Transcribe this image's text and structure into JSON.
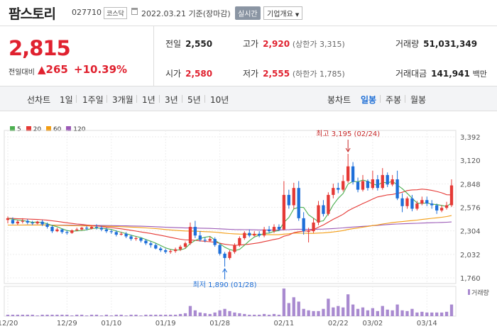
{
  "header": {
    "name": "팜스토리",
    "code": "027710",
    "market": "코스닥",
    "date": "2022.03.21 기준(장마감)",
    "live_label": "실시간",
    "corp_label": "기업개요"
  },
  "quote": {
    "price": "2,815",
    "change_label": "전일대비",
    "change_arrow": "▲",
    "change": "265",
    "change_pct": "+10.39%",
    "prev_close_label": "전일",
    "prev_close": "2,550",
    "open_label": "시가",
    "open": "2,580",
    "high_label": "고가",
    "high": "2,920",
    "upper_limit": "(상한가 3,315)",
    "low_label": "저가",
    "low": "2,555",
    "lower_limit": "(하한가 1,785)",
    "volume_label": "거래량",
    "volume": "51,031,349",
    "amount_label": "거래대금",
    "amount": "141,941",
    "amount_unit": "백만"
  },
  "tabs": {
    "line_chart": "선차트",
    "periods": [
      "1일",
      "1주일",
      "3개월",
      "1년",
      "3년",
      "5년",
      "10년"
    ],
    "candle_chart": "봉차트",
    "candle_periods": [
      "일봉",
      "주봉",
      "월봉"
    ],
    "active_candle": "일봉"
  },
  "legend": [
    {
      "label": "5",
      "color": "#4caf50"
    },
    {
      "label": "20",
      "color": "#e53935"
    },
    {
      "label": "60",
      "color": "#f39c12"
    },
    {
      "label": "120",
      "color": "#9b59b6"
    }
  ],
  "colors": {
    "up": "#e53935",
    "down": "#1e6fd9",
    "volume": "#a98ad0"
  },
  "chart_data": {
    "type": "candlestick",
    "ylim": [
      1760,
      3392
    ],
    "y_ticks": [
      "3,392",
      "3,120",
      "2,848",
      "2,576",
      "2,304",
      "2,032",
      "1,760"
    ],
    "x_tick_labels": [
      "12/20",
      "12/29",
      "01/10",
      "01/19",
      "01/28",
      "02/11",
      "02/22",
      "03/02",
      "03/14"
    ],
    "x_tick_index": [
      0,
      12,
      21,
      32,
      43,
      56,
      67,
      74,
      85
    ],
    "annotations": {
      "high": {
        "text": "최고 3,195 (02/24)",
        "index": 69,
        "value": 3195
      },
      "low": {
        "text": "최저 1,890 (01/28)",
        "index": 44,
        "value": 1890
      }
    },
    "volume_label": "거래량",
    "candles": [
      [
        2430,
        2450,
        2470,
        2390
      ],
      [
        2430,
        2390,
        2460,
        2380
      ],
      [
        2390,
        2410,
        2430,
        2370
      ],
      [
        2410,
        2420,
        2450,
        2390
      ],
      [
        2420,
        2400,
        2440,
        2380
      ],
      [
        2400,
        2390,
        2420,
        2370
      ],
      [
        2390,
        2410,
        2420,
        2380
      ],
      [
        2410,
        2380,
        2430,
        2360
      ],
      [
        2380,
        2350,
        2400,
        2330
      ],
      [
        2350,
        2300,
        2370,
        2280
      ],
      [
        2300,
        2320,
        2340,
        2290
      ],
      [
        2320,
        2290,
        2330,
        2270
      ],
      [
        2290,
        2280,
        2310,
        2260
      ],
      [
        2280,
        2310,
        2320,
        2270
      ],
      [
        2310,
        2320,
        2340,
        2300
      ],
      [
        2320,
        2340,
        2350,
        2310
      ],
      [
        2340,
        2330,
        2360,
        2310
      ],
      [
        2330,
        2350,
        2370,
        2320
      ],
      [
        2350,
        2340,
        2380,
        2320
      ],
      [
        2340,
        2320,
        2360,
        2300
      ],
      [
        2320,
        2300,
        2340,
        2280
      ],
      [
        2300,
        2290,
        2320,
        2270
      ],
      [
        2290,
        2260,
        2310,
        2240
      ],
      [
        2260,
        2270,
        2290,
        2250
      ],
      [
        2270,
        2240,
        2290,
        2220
      ],
      [
        2240,
        2210,
        2260,
        2190
      ],
      [
        2210,
        2220,
        2240,
        2190
      ],
      [
        2220,
        2190,
        2230,
        2170
      ],
      [
        2190,
        2160,
        2210,
        2140
      ],
      [
        2160,
        2140,
        2180,
        2110
      ],
      [
        2140,
        2100,
        2160,
        2090
      ],
      [
        2100,
        2080,
        2120,
        2060
      ],
      [
        2080,
        2060,
        2100,
        2040
      ],
      [
        2060,
        2070,
        2090,
        2040
      ],
      [
        2070,
        2090,
        2110,
        2050
      ],
      [
        2090,
        2120,
        2140,
        2070
      ],
      [
        2120,
        2160,
        2180,
        2100
      ],
      [
        2160,
        2350,
        2400,
        2140
      ],
      [
        2350,
        2250,
        2420,
        2220
      ],
      [
        2250,
        2200,
        2300,
        2180
      ],
      [
        2200,
        2190,
        2230,
        2170
      ],
      [
        2190,
        2210,
        2240,
        2180
      ],
      [
        2210,
        2140,
        2230,
        2120
      ],
      [
        2140,
        2040,
        2160,
        2020
      ],
      [
        2040,
        1990,
        2060,
        1890
      ],
      [
        1990,
        2060,
        2080,
        1970
      ],
      [
        2060,
        2140,
        2160,
        2040
      ],
      [
        2140,
        2220,
        2240,
        2120
      ],
      [
        2220,
        2280,
        2300,
        2200
      ],
      [
        2280,
        2250,
        2320,
        2230
      ],
      [
        2250,
        2270,
        2300,
        2240
      ],
      [
        2270,
        2250,
        2300,
        2230
      ],
      [
        2250,
        2320,
        2350,
        2230
      ],
      [
        2320,
        2300,
        2360,
        2280
      ],
      [
        2300,
        2350,
        2380,
        2280
      ],
      [
        2350,
        2320,
        2380,
        2300
      ],
      [
        2320,
        2720,
        2880,
        2310
      ],
      [
        2720,
        2600,
        2780,
        2560
      ],
      [
        2600,
        2800,
        2860,
        2560
      ],
      [
        2800,
        2450,
        2880,
        2420
      ],
      [
        2450,
        2300,
        2520,
        2260
      ],
      [
        2300,
        2300,
        2340,
        2170
      ],
      [
        2300,
        2400,
        2450,
        2280
      ],
      [
        2400,
        2600,
        2650,
        2370
      ],
      [
        2600,
        2500,
        2660,
        2470
      ],
      [
        2500,
        2720,
        2750,
        2480
      ],
      [
        2720,
        2800,
        2850,
        2680
      ],
      [
        2800,
        2780,
        2860,
        2740
      ],
      [
        2780,
        2880,
        2950,
        2760
      ],
      [
        2880,
        3050,
        3195,
        2860
      ],
      [
        3050,
        2870,
        3100,
        2840
      ],
      [
        2870,
        2780,
        2920,
        2750
      ],
      [
        2780,
        2880,
        2950,
        2760
      ],
      [
        2880,
        2800,
        2900,
        2770
      ],
      [
        2800,
        2900,
        3000,
        2780
      ],
      [
        2900,
        2800,
        2950,
        2770
      ],
      [
        2800,
        2950,
        3030,
        2780
      ],
      [
        2950,
        2840,
        2980,
        2810
      ],
      [
        2840,
        2900,
        2950,
        2820
      ],
      [
        2900,
        2680,
        3000,
        2660
      ],
      [
        2680,
        2590,
        2740,
        2520
      ],
      [
        2590,
        2680,
        2700,
        2560
      ],
      [
        2680,
        2560,
        2720,
        2530
      ],
      [
        2560,
        2620,
        2650,
        2540
      ],
      [
        2620,
        2660,
        2700,
        2600
      ],
      [
        2660,
        2620,
        2700,
        2590
      ],
      [
        2620,
        2600,
        2660,
        2560
      ],
      [
        2600,
        2540,
        2620,
        2500
      ],
      [
        2540,
        2570,
        2600,
        2520
      ],
      [
        2570,
        2600,
        2640,
        2550
      ],
      [
        2600,
        2830,
        2900,
        2580
      ]
    ],
    "volumes": [
      2,
      2,
      2,
      2,
      2,
      2,
      1,
      2,
      2,
      2,
      2,
      2,
      2,
      1,
      2,
      2,
      1,
      2,
      2,
      1,
      2,
      1,
      2,
      2,
      1,
      2,
      2,
      1,
      2,
      2,
      2,
      2,
      2,
      2,
      2,
      3,
      4,
      14,
      8,
      5,
      4,
      3,
      5,
      8,
      10,
      7,
      5,
      4,
      3,
      2,
      2,
      2,
      3,
      2,
      3,
      2,
      38,
      18,
      26,
      20,
      10,
      8,
      7,
      7,
      10,
      24,
      12,
      14,
      12,
      30,
      16,
      10,
      12,
      8,
      11,
      7,
      14,
      9,
      8,
      16,
      8,
      7,
      10,
      5,
      6,
      5,
      5,
      5,
      5,
      6,
      16
    ]
  }
}
